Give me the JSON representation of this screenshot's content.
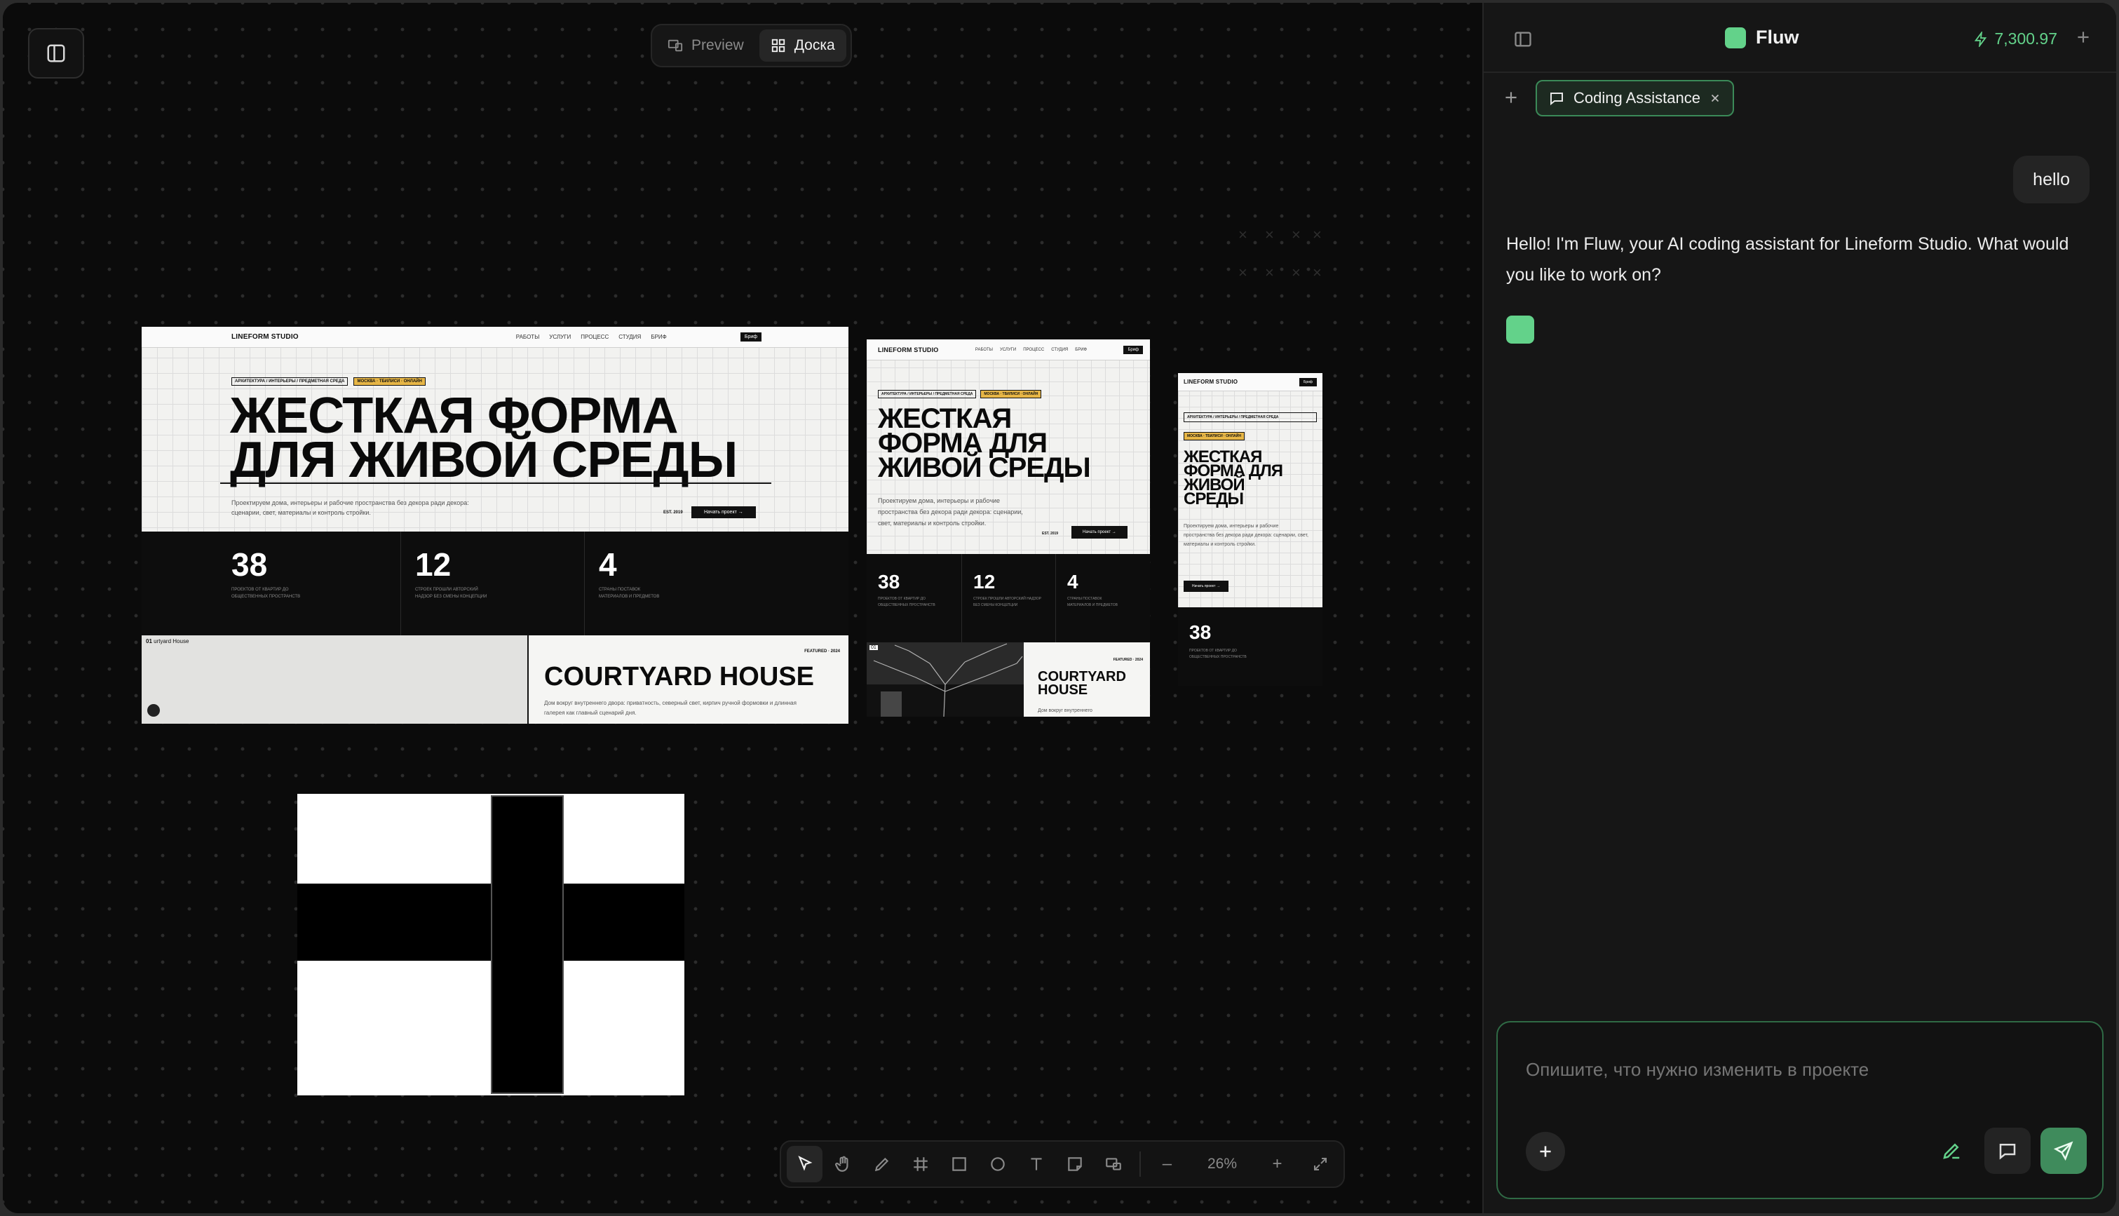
{
  "view_switch": {
    "preview_label": "Preview",
    "board_label": "Доска"
  },
  "artboard_desktop": {
    "logo": "LINEFORM STUDIO",
    "nav": [
      "РАБОТЫ",
      "УСЛУГИ",
      "ПРОЦЕСС",
      "СТУДИЯ",
      "БРИФ"
    ],
    "cta": "Бриф",
    "tag1": "АРХИТЕКТУРА / ИНТЕРЬЕРЫ / ПРЕДМЕТНАЯ СРЕДА",
    "tag2": "МОСКВА · ТБИЛИСИ · ОНЛАЙН",
    "title_line1": "ЖЕСТКАЯ ФОРМА",
    "title_line2": "ДЛЯ ЖИВОЙ СРЕДЫ",
    "lead": "Проектируем дома, интерьеры и рабочие пространства без декора ради декора: сценарии, свет, материалы и контроль стройки.",
    "est": "EST. 2019",
    "start_btn": "Начать проект →",
    "stats": [
      {
        "num": "38",
        "desc": "ПРОЕКТОВ ОТ КВАРТИР ДО ОБЩЕСТВЕННЫХ ПРОСТРАНСТВ"
      },
      {
        "num": "12",
        "desc": "СТРОЕК ПРОШЛИ АВТОРСКИЙ НАДЗОР БЕЗ СМЕНЫ КОНЦЕПЦИИ"
      },
      {
        "num": "4",
        "desc": "СТРАНЫ ПОСТАВОК МАТЕРИАЛОВ И ПРЕДМЕТОВ"
      }
    ],
    "image_caption_num": "01",
    "image_caption": "urtyard House",
    "featured_label": "FEATURED · 2024",
    "featured_title": "COURTYARD HOUSE",
    "featured_desc": "Дом вокруг внутреннего двора: приватность, северный свет, кирпич ручной формовки и длинная галерея как главный сценарий дня."
  },
  "artboard_tablet": {
    "logo": "LINEFORM STUDIO",
    "nav": [
      "РАБОТЫ",
      "УСЛУГИ",
      "ПРОЦЕСС",
      "СТУДИЯ",
      "БРИФ"
    ],
    "cta": "Бриф",
    "tag1": "АРХИТЕКТУРА / ИНТЕРЬЕРЫ / ПРЕДМЕТНАЯ СРЕДА",
    "tag2": "МОСКВА · ТБИЛИСИ · ОНЛАЙН",
    "title_line1": "ЖЕСТКАЯ",
    "title_line2": "ФОРМА ДЛЯ",
    "title_line3": "ЖИВОЙ СРЕДЫ",
    "lead": "Проектируем дома, интерьеры и рабочие пространства без декора ради декора: сценарии, свет, материалы и контроль стройки.",
    "est": "EST. 2019",
    "start_btn": "Начать проект →",
    "stats": [
      {
        "num": "38",
        "desc": "ПРОЕКТОВ ОТ КВАРТИР ДО ОБЩЕСТВЕННЫХ ПРОСТРАНСТВ"
      },
      {
        "num": "12",
        "desc": "СТРОЕК ПРОШЛИ АВТОРСКИЙ НАДЗОР БЕЗ СМЕНЫ КОНЦЕПЦИИ"
      },
      {
        "num": "4",
        "desc": "СТРАНЫ ПОСТАВОК МАТЕРИАЛОВ И ПРЕДМЕТОВ"
      }
    ],
    "image_caption_num": "01",
    "featured_label": "FEATURED · 2024",
    "featured_title_line1": "COURTYARD",
    "featured_title_line2": "HOUSE",
    "featured_desc": "Дом вокруг внутреннего"
  },
  "artboard_mobile": {
    "logo": "LINEFORM STUDIO",
    "cta": "Бриф",
    "tag1": "АРХИТЕКТУРА / ИНТЕРЬЕРЫ / ПРЕДМЕТНАЯ СРЕДА",
    "tag2": "МОСКВА · ТБИЛИСИ · ОНЛАЙН",
    "title_line1": "ЖЕСТКАЯ",
    "title_line2": "ФОРМА ДЛЯ",
    "title_line3": "ЖИВОЙ",
    "title_line4": "СРЕДЫ",
    "lead": "Проектируем дома, интерьеры и рабочие пространства без декора ради декора: сценарии, свет, материалы и контроль стройки.",
    "start_btn": "Начать проект →",
    "stat_num": "38",
    "stat_desc": "ПРОЕКТОВ ОТ КВАРТИР ДО ОБЩЕСТВЕННЫХ ПРОСТРАНСТВ"
  },
  "toolbar": {
    "tools": [
      "select-icon",
      "hand-icon",
      "pen-icon",
      "frame-icon",
      "rectangle-icon",
      "ellipse-icon",
      "text-icon",
      "note-icon",
      "component-icon"
    ],
    "zoom_out": "–",
    "zoom_value": "26%",
    "zoom_in": "+"
  },
  "panel": {
    "brand": "Fluw",
    "credits": "7,300.97",
    "tab_label": "Coding Assistance",
    "user_message": "hello",
    "assistant_message": "Hello! I'm Fluw, your AI coding assistant for Lineform Studio. What would you like to work on?",
    "composer_placeholder": "Опишите, что нужно изменить в проекте"
  },
  "colors": {
    "accent_green": "#63d28a",
    "canvas_bg": "#0b0b0b",
    "panel_bg": "#161616",
    "tag_yellow": "#e7b646"
  }
}
